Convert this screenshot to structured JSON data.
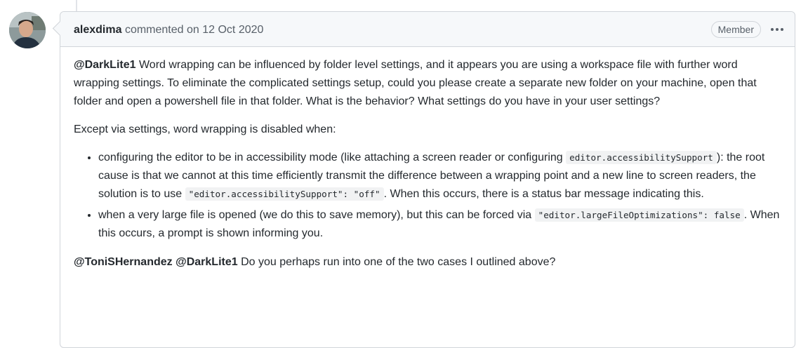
{
  "comment": {
    "author": "alexdima",
    "action_text": "commented on",
    "date": "12 Oct 2020",
    "role_badge": "Member",
    "menu_icon": "kebab-horizontal-icon",
    "body": {
      "p1": {
        "mention": "@DarkLite1",
        "text": " Word wrapping can be influenced by folder level settings, and it appears you are using a workspace file with further word wrapping settings. To eliminate the complicated settings setup, could you please create a separate new folder on your machine, open that folder and open a powershell file in that folder. What is the behavior? What settings do you have in your user settings?"
      },
      "p2": "Except via settings, word wrapping is disabled when:",
      "bullets": [
        {
          "t1": "configuring the editor to be in accessibility mode (like attaching a screen reader or configuring ",
          "code1": "editor.accessibilitySupport",
          "t2": "): the root cause is that we cannot at this time efficiently transmit the difference between a wrapping point and a new line to screen readers, the solution is to use ",
          "code2": "\"editor.accessibilitySupport\": \"off\"",
          "t3": ". When this occurs, there is a status bar message indicating this."
        },
        {
          "t1": "when a very large file is opened (we do this to save memory), but this can be forced via ",
          "code1": "\"editor.largeFileOptimizations\": false",
          "t2": ". When this occurs, a prompt is shown informing you."
        }
      ],
      "p3": {
        "mention1": "@ToniSHernandez",
        "mention2": "@DarkLite1",
        "text": " Do you perhaps run into one of the two cases I outlined above?"
      }
    }
  },
  "colors": {
    "border": "#d1d5da",
    "header_bg": "#f6f8fa",
    "text": "#24292e",
    "muted": "#586069"
  }
}
